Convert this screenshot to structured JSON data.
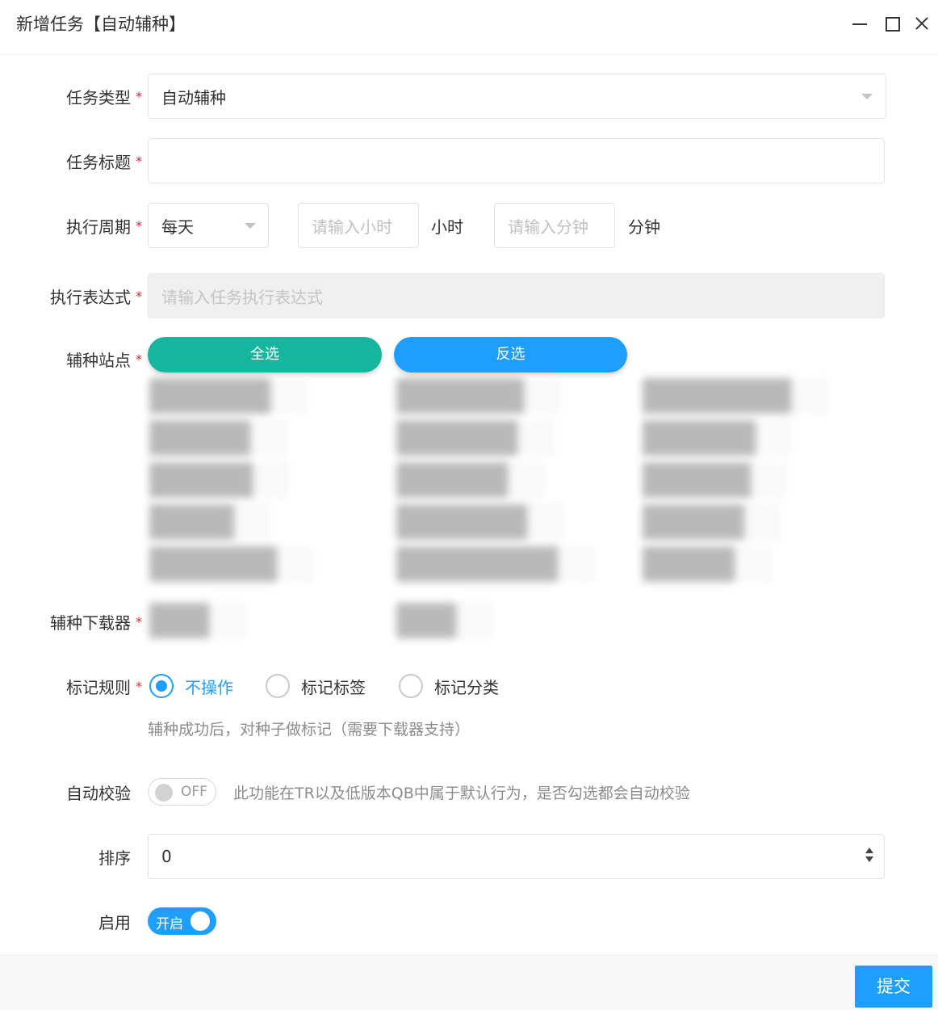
{
  "window": {
    "title": "新增任务【自动辅种】"
  },
  "form": {
    "task_type": {
      "label": "任务类型",
      "value": "自动辅种"
    },
    "task_title": {
      "label": "任务标题",
      "value": ""
    },
    "period": {
      "label": "执行周期",
      "value": "每天",
      "hour_placeholder": "请输入小时",
      "hour_unit": "小时",
      "minute_placeholder": "请输入分钟",
      "minute_unit": "分钟"
    },
    "expression": {
      "label": "执行表达式",
      "placeholder": "请输入任务执行表达式"
    },
    "sites": {
      "label": "辅种站点",
      "select_all": "全选",
      "invert": "反选"
    },
    "downloader": {
      "label": "辅种下载器"
    },
    "mark_rule": {
      "label": "标记规则",
      "options": [
        "不操作",
        "标记标签",
        "标记分类"
      ],
      "selected": "不操作",
      "hint": "辅种成功后，对种子做标记（需要下载器支持）"
    },
    "auto_check": {
      "label": "自动校验",
      "state": "OFF",
      "hint": "此功能在TR以及低版本QB中属于默认行为，是否勾选都会自动校验"
    },
    "sort": {
      "label": "排序",
      "value": "0"
    },
    "enable": {
      "label": "启用",
      "state": "开启"
    }
  },
  "footer": {
    "submit_label": "提交"
  },
  "colors": {
    "primary": "#1e9fff",
    "teal": "#16b69e",
    "required": "#f5222d"
  }
}
